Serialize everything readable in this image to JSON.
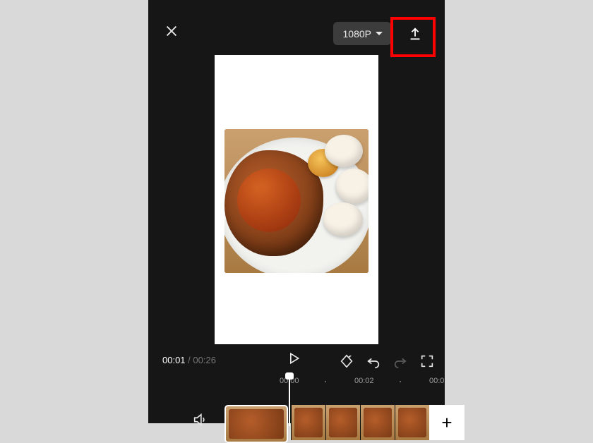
{
  "topbar": {
    "resolution_label": "1080P"
  },
  "timecode": {
    "current": "00:01",
    "separator": " / ",
    "duration": "00:26"
  },
  "ruler": {
    "t0": "00:00",
    "t1": "00:02",
    "t2": "00:0"
  },
  "icons": {
    "close": "close-icon",
    "export": "export-icon",
    "play": "play-icon",
    "keyframe": "keyframe-icon",
    "undo": "undo-icon",
    "redo": "redo-icon",
    "fullscreen": "fullscreen-icon",
    "speaker": "speaker-icon"
  },
  "track": {
    "add_label": "+"
  }
}
